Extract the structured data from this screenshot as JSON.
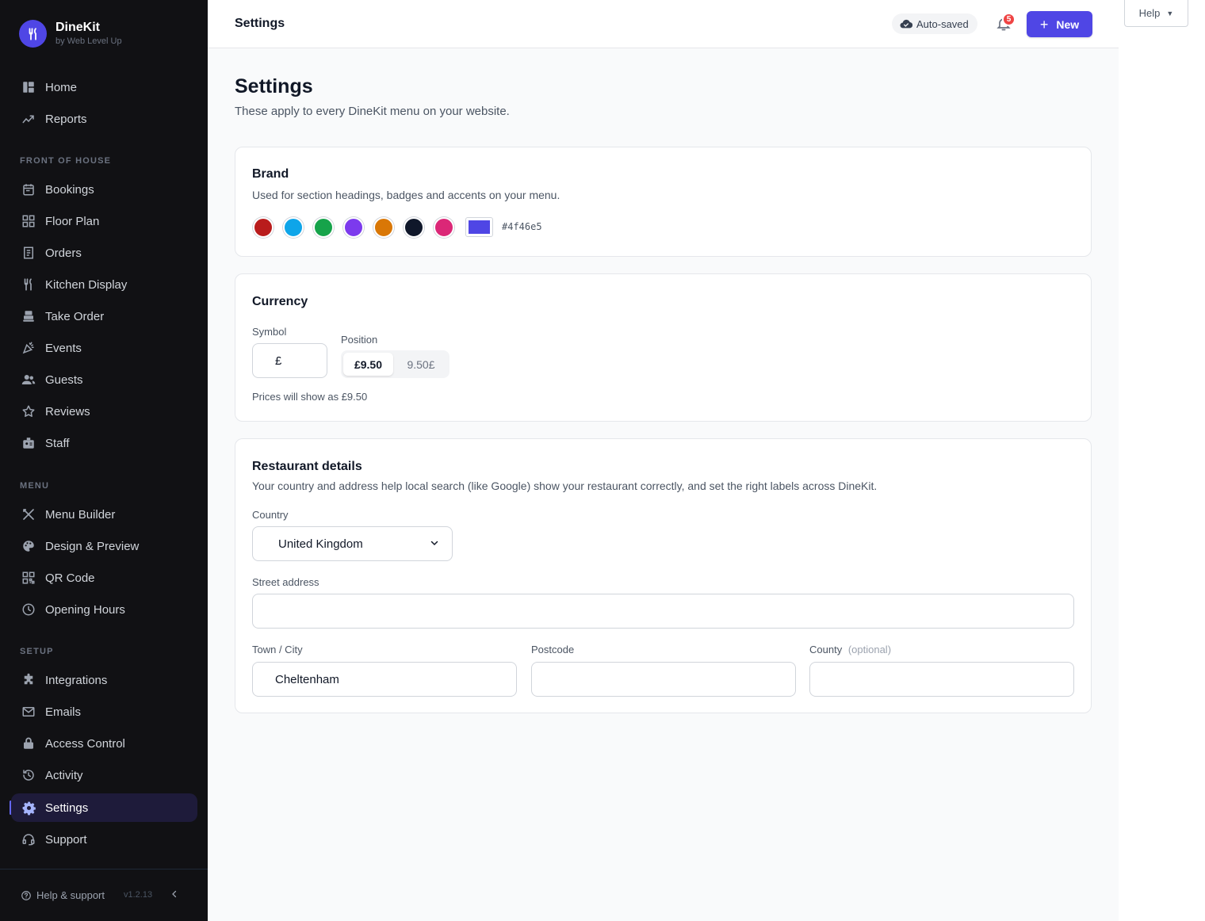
{
  "brand": {
    "name": "DineKit",
    "sub": "by Web Level Up"
  },
  "sidebar": {
    "top": [
      {
        "label": "Home",
        "icon": "home-icon"
      },
      {
        "label": "Reports",
        "icon": "reports-icon"
      }
    ],
    "sections": {
      "front_of_house": "FRONT OF HOUSE",
      "menu": "MENU",
      "setup": "SETUP"
    },
    "front_of_house": [
      {
        "label": "Bookings",
        "icon": "bookings-icon"
      },
      {
        "label": "Floor Plan",
        "icon": "floor-plan-icon"
      },
      {
        "label": "Orders",
        "icon": "orders-icon"
      },
      {
        "label": "Kitchen Display",
        "icon": "kitchen-icon"
      },
      {
        "label": "Take Order",
        "icon": "take-order-icon"
      },
      {
        "label": "Events",
        "icon": "events-icon"
      },
      {
        "label": "Guests",
        "icon": "guests-icon"
      },
      {
        "label": "Reviews",
        "icon": "reviews-icon"
      },
      {
        "label": "Staff",
        "icon": "staff-icon"
      }
    ],
    "menu": [
      {
        "label": "Menu Builder",
        "icon": "menu-builder-icon"
      },
      {
        "label": "Design & Preview",
        "icon": "palette-icon"
      },
      {
        "label": "QR Code",
        "icon": "qr-code-icon"
      },
      {
        "label": "Opening Hours",
        "icon": "clock-icon"
      }
    ],
    "setup": [
      {
        "label": "Integrations",
        "icon": "puzzle-icon"
      },
      {
        "label": "Emails",
        "icon": "mail-icon"
      },
      {
        "label": "Access Control",
        "icon": "lock-icon"
      },
      {
        "label": "Activity",
        "icon": "history-icon"
      },
      {
        "label": "Settings",
        "icon": "gear-icon",
        "active": true
      },
      {
        "label": "Support",
        "icon": "support-icon"
      }
    ],
    "footer": {
      "help": "Help & support",
      "version": "v1.2.13"
    }
  },
  "topbar": {
    "title": "Settings",
    "autosaved": "Auto-saved",
    "notifications": "5",
    "new_label": "New",
    "help_label": "Help"
  },
  "page": {
    "title": "Settings",
    "subtitle": "These apply to every DineKit menu on your website."
  },
  "brand_card": {
    "title": "Brand",
    "desc": "Used for section headings, badges and accents on your menu.",
    "swatches": [
      "#b91c1c",
      "#0ea5e9",
      "#16a34a",
      "#7c3aed",
      "#d97706",
      "#0f172a",
      "#db2777"
    ],
    "selected_color": "#4f46e5",
    "hex_label": "#4f46e5"
  },
  "currency_card": {
    "title": "Currency",
    "symbol_label": "Symbol",
    "symbol_value": "£",
    "position_label": "Position",
    "position_options": [
      "£9.50",
      "9.50£"
    ],
    "position_selected": "£9.50",
    "hint": "Prices will show as £9.50"
  },
  "restaurant_card": {
    "title": "Restaurant details",
    "desc": "Your country and address help local search (like Google) show your restaurant correctly, and set the right labels across DineKit.",
    "country_label": "Country",
    "country_value": "United Kingdom",
    "street_label": "Street address",
    "street_value": "",
    "town_label": "Town / City",
    "town_value": "Cheltenham",
    "postcode_label": "Postcode",
    "postcode_value": "",
    "county_label": "County",
    "county_optional": "(optional)",
    "county_value": ""
  }
}
